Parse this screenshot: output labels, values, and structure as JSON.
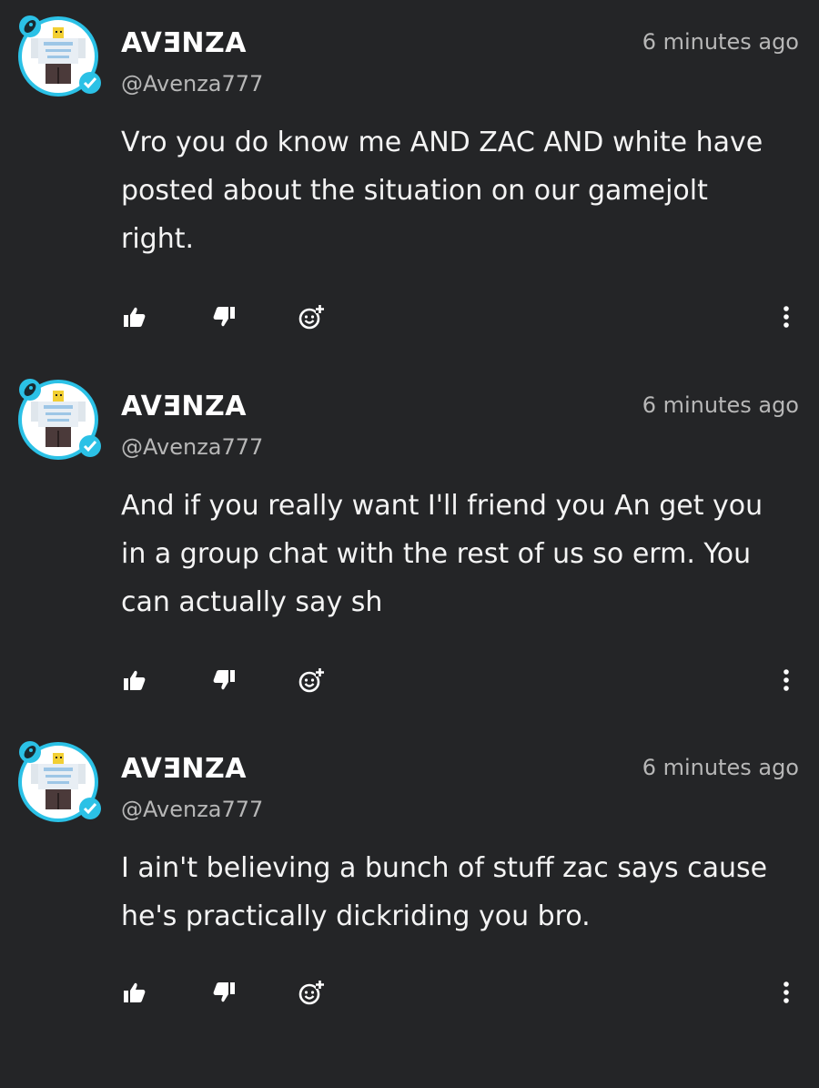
{
  "comments": [
    {
      "username": "AVƎNZA",
      "handle": "@Avenza777",
      "timestamp": "6 minutes ago",
      "body": "Vro you do know me AND ZAC AND white have posted about the situation on our gamejolt right."
    },
    {
      "username": "AVƎNZA",
      "handle": "@Avenza777",
      "timestamp": "6 minutes ago",
      "body": "And if you really want I'll friend you An get you in a group chat with the rest of us so erm. You can actually say sh"
    },
    {
      "username": "AVƎNZA",
      "handle": "@Avenza777",
      "timestamp": "6 minutes ago",
      "body": "I ain't believing a bunch of stuff zac says cause he's practically dickriding you bro."
    }
  ],
  "icons": {
    "like": "thumbs-up-icon",
    "dislike": "thumbs-down-icon",
    "react": "add-reaction-icon",
    "more": "more-vertical-icon"
  },
  "colors": {
    "background": "#242527",
    "avatar_ring": "#2bc1e6",
    "text": "#f4f4f4",
    "muted": "#b7b7b7"
  }
}
